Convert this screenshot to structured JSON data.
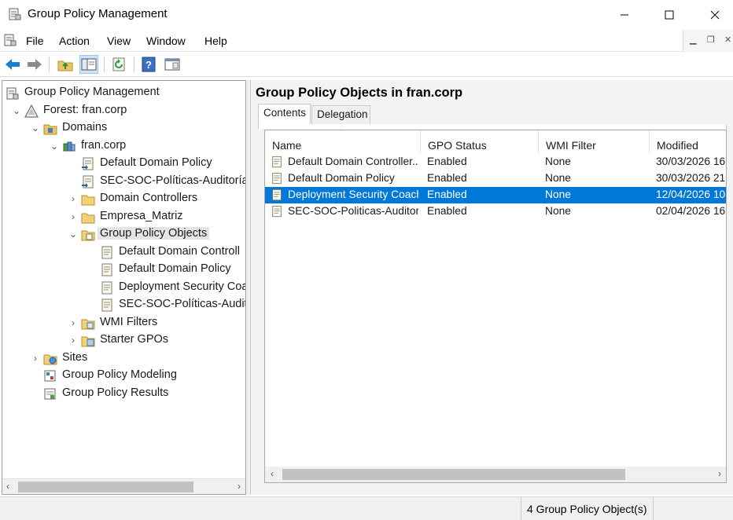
{
  "window": {
    "title": "Group Policy Management"
  },
  "menu": [
    "File",
    "Action",
    "View",
    "Window",
    "Help"
  ],
  "tree": [
    {
      "label": "Group Policy Management",
      "icon": "gpm-icon"
    },
    {
      "label": "Forest: fran.corp",
      "icon": "forest-icon"
    },
    {
      "label": "Domains",
      "icon": "domains-icon"
    },
    {
      "label": "fran.corp",
      "icon": "domain-icon"
    },
    {
      "label": "Default Domain Policy",
      "icon": "gpo-link-icon"
    },
    {
      "label": "SEC-SOC-Políticas-Auditoría",
      "icon": "gpo-link-icon"
    },
    {
      "label": "Domain Controllers",
      "icon": "ou-icon"
    },
    {
      "label": "Empresa_Matriz",
      "icon": "ou-icon"
    },
    {
      "label": "Group Policy Objects",
      "icon": "gpo-folder-icon"
    },
    {
      "label": "Default Domain Controll",
      "icon": "gpo-icon"
    },
    {
      "label": "Default Domain Policy",
      "icon": "gpo-icon"
    },
    {
      "label": "Deployment Security Coa",
      "icon": "gpo-icon"
    },
    {
      "label": "SEC-SOC-Políticas-Audito",
      "icon": "gpo-icon"
    },
    {
      "label": "WMI Filters",
      "icon": "wmi-folder-icon"
    },
    {
      "label": "Starter GPOs",
      "icon": "starter-folder-icon"
    },
    {
      "label": "Sites",
      "icon": "sites-icon"
    },
    {
      "label": "Group Policy Modeling",
      "icon": "modeling-icon"
    },
    {
      "label": "Group Policy Results",
      "icon": "results-icon"
    }
  ],
  "right": {
    "title": "Group Policy Objects in fran.corp",
    "tabs": [
      "Contents",
      "Delegation"
    ],
    "columns": [
      "Name",
      "GPO Status",
      "WMI Filter",
      "Modified"
    ],
    "rows": [
      {
        "name": "Default Domain Controller...",
        "status": "Enabled",
        "wmi": "None",
        "modified": "30/03/2026 16"
      },
      {
        "name": "Default Domain Policy",
        "status": "Enabled",
        "wmi": "None",
        "modified": "30/03/2026 21"
      },
      {
        "name": "Deployment Security Coach",
        "status": "Enabled",
        "wmi": "None",
        "modified": "12/04/2026 10"
      },
      {
        "name": "SEC-SOC-Politicas-Auditoria",
        "status": "Enabled",
        "wmi": "None",
        "modified": "02/04/2026 16"
      }
    ]
  },
  "status": {
    "text": "4 Group Policy Object(s)"
  },
  "colors": {
    "selection": "#0078d7",
    "back_arrow": "#1e7fd1"
  }
}
